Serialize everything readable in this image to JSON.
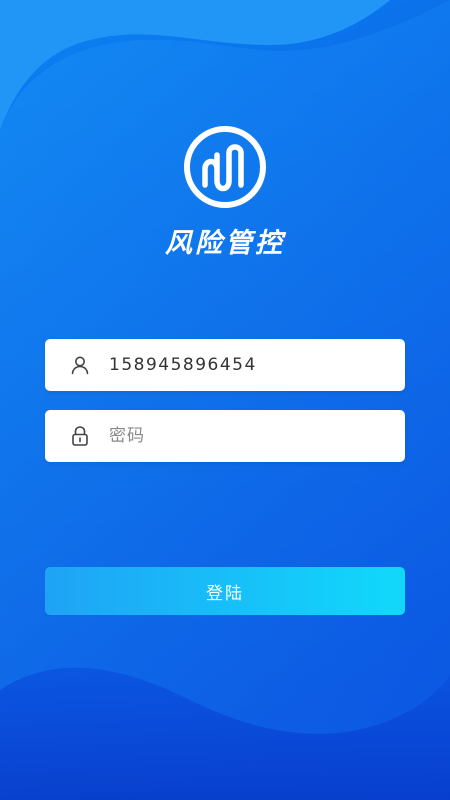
{
  "app": {
    "title": "风险管控",
    "logo": "wave-circle-logo"
  },
  "login": {
    "username_value": "158945896454",
    "username_icon": "user-icon",
    "password_placeholder": "密码",
    "password_value": "",
    "password_icon": "lock-icon",
    "submit_label": "登陆"
  },
  "colors": {
    "background_top": "#0b7df0",
    "background_bottom": "#0a44d8",
    "button_gradient_start": "#1fa3f5",
    "button_gradient_end": "#11d9fb",
    "field_background": "#ffffff"
  }
}
